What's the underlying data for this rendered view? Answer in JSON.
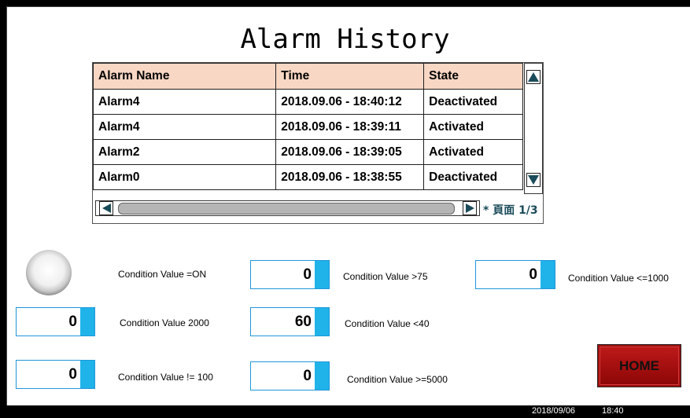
{
  "title": "Alarm History",
  "alarm_table": {
    "columns": [
      "Alarm Name",
      "Time",
      "State"
    ],
    "rows": [
      [
        "Alarm4",
        "2018.09.06 - 18:40:12",
        "Deactivated"
      ],
      [
        "Alarm4",
        "2018.09.06 - 18:39:11",
        "Activated"
      ],
      [
        "Alarm2",
        "2018.09.06 - 18:39:05",
        "Activated"
      ],
      [
        "Alarm0",
        "2018.09.06 - 18:38:55",
        "Deactivated"
      ]
    ],
    "page_label": "* 頁面 1/3"
  },
  "conditions": {
    "lamp_label": "Condition Value =ON",
    "gt75": {
      "value": "0",
      "label": "Condition Value >75"
    },
    "le1000": {
      "value": "0",
      "label": "Condition Value  <=1000"
    },
    "v2000": {
      "value": "0",
      "label": "Condition Value 2000"
    },
    "lt40": {
      "value": "60",
      "label": "Condition Value  <40"
    },
    "ne100": {
      "value": "0",
      "label": "Condition Value != 100"
    },
    "ge5000": {
      "value": "0",
      "label": "Condition Value  >=5000"
    }
  },
  "home_button": "HOME",
  "status_bar": {
    "date": "2018/09/06",
    "time": "18:40"
  },
  "colors": {
    "header_bg": "#f8d7c4",
    "display_accent": "#1fb3ea",
    "home_button": "#b01212"
  },
  "icons": [
    "scroll-up-arrow-icon",
    "scroll-down-arrow-icon",
    "scroll-left-arrow-icon",
    "scroll-right-arrow-icon",
    "indicator-lamp-icon"
  ]
}
